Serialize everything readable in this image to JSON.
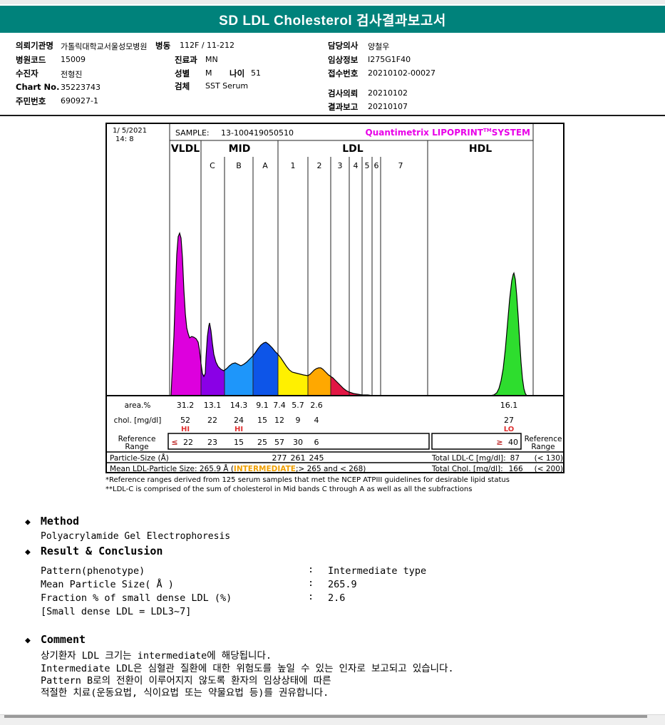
{
  "title": "SD LDL Cholesterol 검사결과보고서",
  "patient": {
    "f1": {
      "label": "의뢰기관명",
      "value": "가톨릭대학교서울성모병원"
    },
    "f1b": {
      "label": "병동",
      "value": "112F / 11-212"
    },
    "f2": {
      "label": "병원코드",
      "value": "15009"
    },
    "f2b": {
      "label": "진료과",
      "value": "MN"
    },
    "f3": {
      "label": "수진자",
      "value": "전형진"
    },
    "f3b": {
      "label": "성별",
      "value": "M"
    },
    "f3c": {
      "label": "나이",
      "value": "51"
    },
    "f4": {
      "label": "Chart No.",
      "value": "35223743"
    },
    "f4b": {
      "label": "검체",
      "value": "SST Serum"
    },
    "f5": {
      "label": "주민번호",
      "value": "690927-1"
    },
    "g1": {
      "label": "담당의사",
      "value": "양철우"
    },
    "g2": {
      "label": "임상정보",
      "value": "I275G1F40"
    },
    "g3": {
      "label": "접수번호",
      "value": "20210102-00027"
    },
    "g4": {
      "label": "검사의뢰",
      "value": "20210102"
    },
    "g5": {
      "label": "결과보고",
      "value": "20210107"
    }
  },
  "chart": {
    "datetime_line1": "1/ 5/2021",
    "datetime_line2": "14: 8",
    "sample_label": "SAMPLE:",
    "brand_prefix": "Quantimetrix LIPOPRINT",
    "brand_tm": "TM",
    "brand_suffix": "SYSTEM",
    "headers": {
      "vldl": "VLDL",
      "mid": "MID",
      "ldl": "LDL",
      "hdl": "HDL"
    },
    "sub": {
      "c": "C",
      "b": "B",
      "a": "A",
      "n1": "1",
      "n2": "2",
      "n3": "3",
      "n4": "4",
      "n5": "5",
      "n6": "6",
      "n7": "7"
    },
    "rows": {
      "area": "area.%",
      "chol": "chol. [mg/dl]",
      "ref1": "Reference",
      "ref2": "Range",
      "particle": "Particle-Size (Å)",
      "mean_prefix": "Mean LDL-Particle Size:   265.9 Å (",
      "mean_highlight": "INTERMEDIATE",
      "mean_suffix": ";> 265 and < 268)"
    },
    "footnote1": "*Reference ranges derived from 125 serum samples that met the NCEP ATPIII guidelines for desirable lipid status",
    "footnote2": "**LDL-C is comprised of the sum of cholesterol in Mid bands C through A as well as all the subfractions"
  },
  "chart_data": {
    "type": "area",
    "title": "Quantimetrix LIPOPRINT SYSTEM lipoprotein subfraction profile",
    "sample_id": "13-100419050510",
    "measured_at": "1/ 5/2021 14: 8",
    "bands": [
      {
        "band": "VLDL",
        "area": "31.2",
        "chol": "52",
        "flag": "HI",
        "ref_sign": "≤",
        "ref": "22"
      },
      {
        "band": "MID C",
        "area": "13.1",
        "chol": "22",
        "ref": "23"
      },
      {
        "band": "MID B",
        "area": "14.3",
        "chol": "24",
        "flag": "HI",
        "ref": "15"
      },
      {
        "band": "MID A",
        "area": "9.1",
        "chol": "15",
        "ref": "25"
      },
      {
        "band": "LDL 1",
        "area": "7.4",
        "chol": "12",
        "ref": "57",
        "particle": "277"
      },
      {
        "band": "LDL 2",
        "area": "5.7",
        "chol": "9",
        "ref": "30",
        "particle": "261"
      },
      {
        "band": "LDL 3",
        "area": "2.6",
        "chol": "4",
        "ref": "6",
        "particle": "245"
      },
      {
        "band": "HDL",
        "area": "16.1",
        "chol": "27",
        "flag": "LO",
        "ref_sign": "≥",
        "ref": "40"
      }
    ],
    "totals": {
      "ldl_c_label": "Total LDL-C [mg/dl]:",
      "ldl_c": "87",
      "ldl_c_ref": "(< 130)",
      "chol_label": "Total Chol. [mg/dl]:",
      "chol": "166",
      "chol_ref": "(< 200)"
    },
    "mean_particle_size": "265.9",
    "pattern": "Intermediate type",
    "colors": {
      "vldl": "#dd00dd",
      "midc": "#8a00e6",
      "midb": "#1e96fa",
      "mida": "#0d55e8",
      "ldl1": "#fff000",
      "ldl2": "#ffa800",
      "ldl3": "#e11744",
      "hdl": "#2edd2e"
    }
  },
  "sections": {
    "bullet": "◆",
    "method": {
      "heading": "Method",
      "body": "Polyacrylamide Gel Electrophoresis"
    },
    "result": {
      "heading": "Result & Conclusion",
      "r1": {
        "label": "Pattern(phenotype)",
        "colon": ":",
        "value": "Intermediate type"
      },
      "r2": {
        "label": "Mean Particle Size( Å )",
        "colon": ":",
        "value": "265.9"
      },
      "r3": {
        "label": "Fraction % of small dense LDL (%)",
        "colon": ":",
        "value": "2.6"
      },
      "r4": {
        "label": "[Small dense LDL = LDL3~7]"
      }
    },
    "comment": {
      "heading": "Comment",
      "l1": "상기환자 LDL 크기는 intermediate에 해당됩니다.",
      "l2": "Intermediate LDL은 심혈관 질환에 대한 위험도를 높일 수 있는 인자로 보고되고 있습니다.",
      "l3": "Pattern B로의 전환이 이루어지지 않도록 환자의 임상상태에 따른",
      "l4": "적절한 치료(운동요법, 식이요법 또는 약물요법 등)를 권유합니다."
    }
  }
}
